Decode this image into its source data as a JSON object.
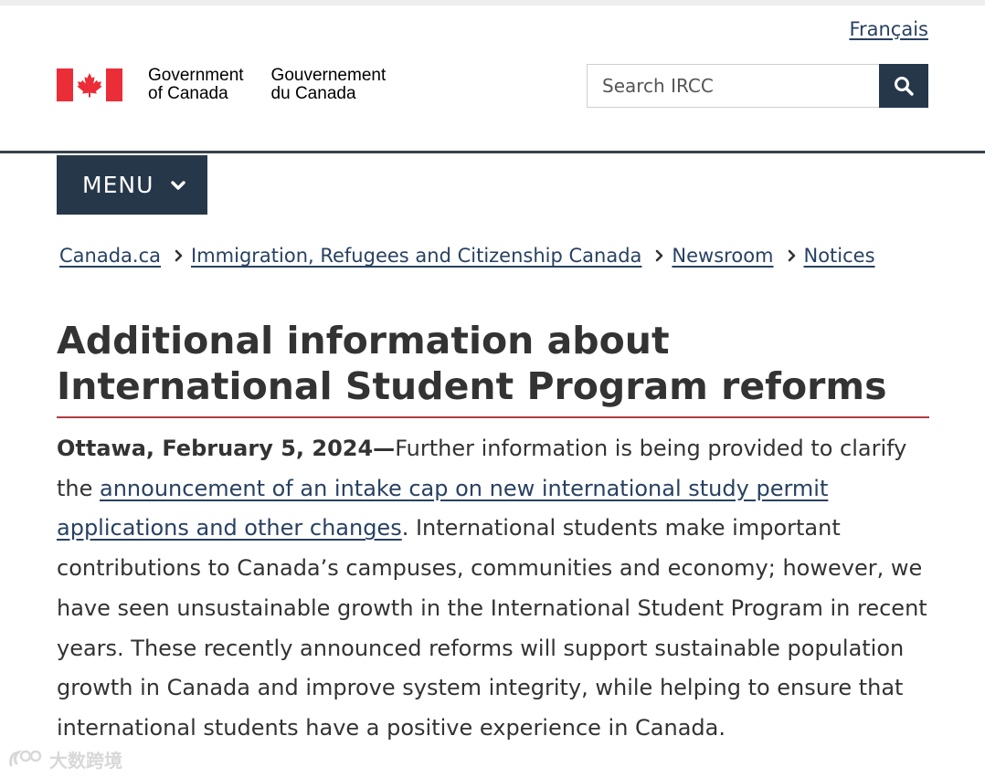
{
  "header": {
    "language_toggle": "Français",
    "signature_en_line1": "Government",
    "signature_en_line2": "of Canada",
    "signature_fr_line1": "Gouvernement",
    "signature_fr_line2": "du Canada",
    "search_placeholder": "Search IRCC",
    "search_icon": "search-icon",
    "flag_icon": "canada-flag-icon"
  },
  "menu": {
    "label": "MENU",
    "icon": "chevron-down-icon"
  },
  "breadcrumb": [
    "Canada.ca",
    "Immigration, Refugees and Citizenship Canada",
    "Newsroom",
    "Notices"
  ],
  "article": {
    "title": "Additional information about International Student Program reforms",
    "lead": "Ottawa, February 5, 2024—",
    "text_before_link": "Further information is being provided to clarify the ",
    "link_text": "announcement of an intake cap on new international study permit applications and other changes",
    "text_after_link": ". International students make important contributions to Canada’s campuses, communities and economy; however, we have seen unsustainable growth in the International Student Program in recent years. These recently announced reforms will support sustainable population growth in Canada and improve system integrity, while helping to ensure that international students have a positive experience in Canada."
  },
  "watermark": {
    "text": "大数跨境"
  },
  "colors": {
    "navy": "#26374a",
    "link": "#284162",
    "flag_red": "#eb2d37",
    "title_rule": "#af3c43"
  }
}
